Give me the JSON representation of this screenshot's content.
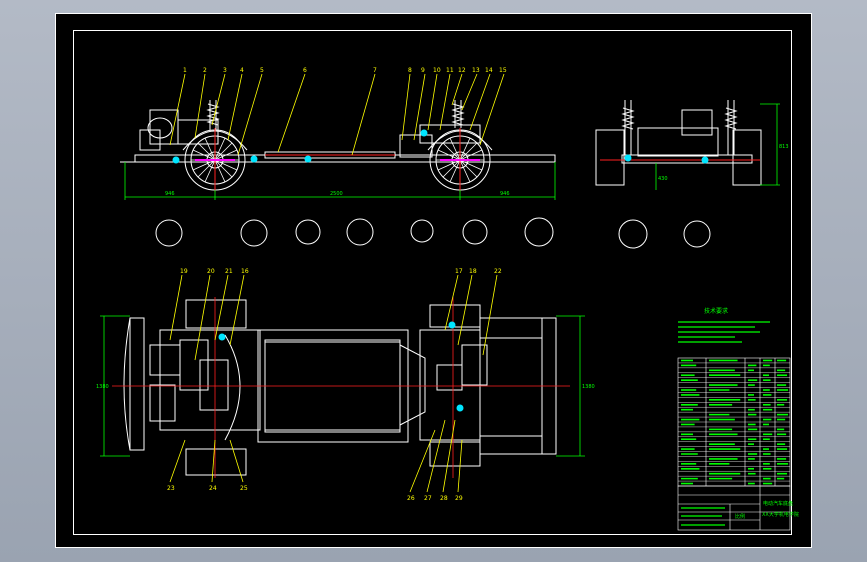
{
  "drawing": {
    "side_view_dims": {
      "left": "946",
      "middle": "2500",
      "right": "946"
    },
    "side_view_callouts": [
      "1",
      "2",
      "3",
      "4",
      "5",
      "6",
      "7",
      "8",
      "9",
      "10",
      "11",
      "12",
      "13",
      "14",
      "15"
    ],
    "front_view_dims": {
      "height": "813",
      "inner": "430"
    },
    "plan_view_dims": {
      "left": "1380",
      "right": "1380"
    },
    "plan_callouts_top_left": [
      "19",
      "20",
      "21",
      "16"
    ],
    "plan_callouts_top_right": [
      "17",
      "18",
      "22"
    ],
    "plan_callouts_bottom_left": [
      "23",
      "24",
      "25"
    ],
    "plan_callouts_bottom_right": [
      "26",
      "27",
      "28",
      "29"
    ],
    "notes_title": "技术要求"
  },
  "title_block": {
    "drawing_title": "电动汽车底盘",
    "company": "XX大学机电学院",
    "scale_label": "比例"
  },
  "colors": {
    "line": "#ffffff",
    "dimension": "#00ff00",
    "center": "#ff2020",
    "callout": "#ffff00",
    "hub": "#00e5ff",
    "axle": "#ff00ff"
  }
}
